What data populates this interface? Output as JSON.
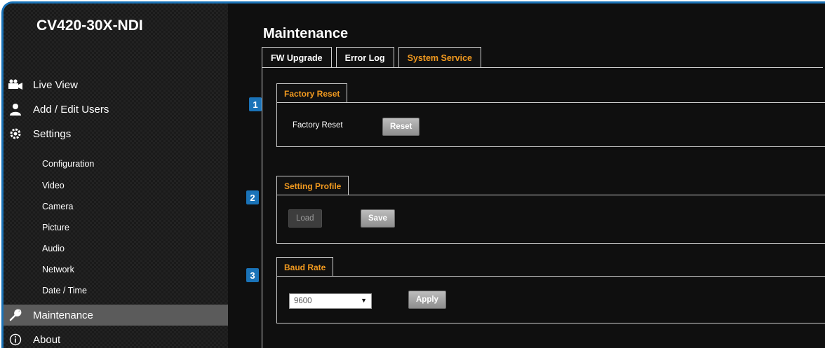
{
  "device": {
    "name": "CV420-30X-NDI"
  },
  "sidebar": {
    "main_items": [
      {
        "label": "Live View",
        "icon": "camera-icon"
      },
      {
        "label": "Add / Edit Users",
        "icon": "user-icon"
      },
      {
        "label": "Settings",
        "icon": "gear-icon"
      }
    ],
    "sub_items": [
      "Configuration",
      "Video",
      "Camera",
      "Picture",
      "Audio",
      "Network",
      "Date / Time"
    ],
    "bottom_items": [
      {
        "label": "Maintenance",
        "icon": "wrench-icon",
        "active": true
      },
      {
        "label": "About",
        "icon": "info-icon"
      }
    ]
  },
  "page": {
    "title": "Maintenance",
    "tabs": [
      {
        "label": "FW Upgrade",
        "active": false
      },
      {
        "label": "Error Log",
        "active": false
      },
      {
        "label": "System Service",
        "active": true
      }
    ]
  },
  "sections": {
    "factory_reset": {
      "number": "1",
      "title": "Factory Reset",
      "label": "Factory Reset",
      "button": "Reset"
    },
    "setting_profile": {
      "number": "2",
      "title": "Setting Profile",
      "load_button": "Load",
      "save_button": "Save"
    },
    "baud_rate": {
      "number": "3",
      "title": "Baud Rate",
      "selected": "9600",
      "apply_button": "Apply"
    }
  },
  "colors": {
    "accent": "#f29a1f",
    "badge": "#1a73b8",
    "frame": "#1a73b8"
  }
}
